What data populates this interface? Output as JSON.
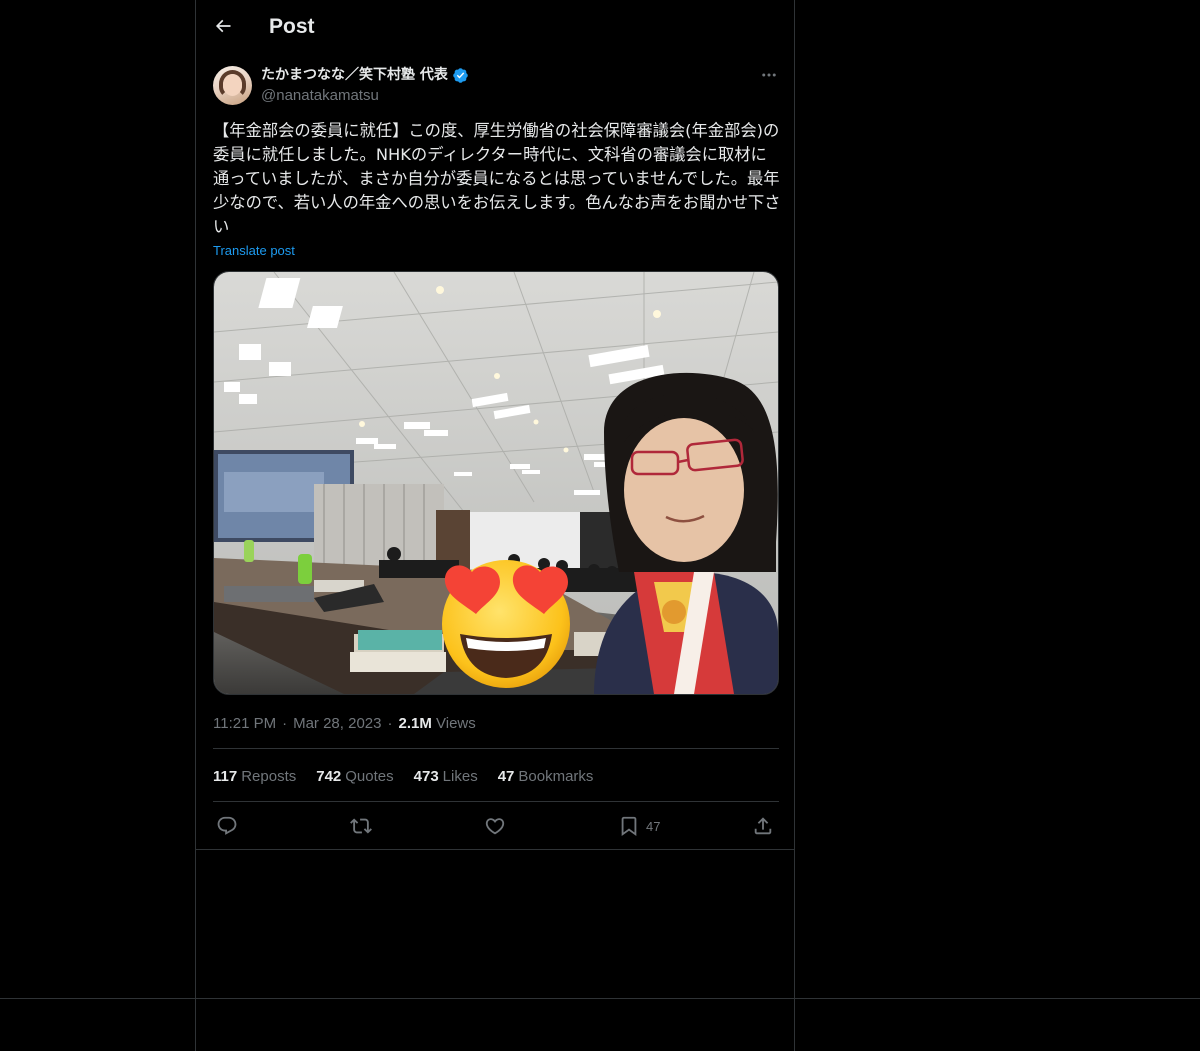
{
  "header": {
    "title": "Post",
    "back_icon": "arrow-left-icon"
  },
  "author": {
    "name": "たかまつなな／笑下村塾 代表",
    "handle": "@nanatakamatsu",
    "verified": true,
    "verified_color": "#1d9bf0"
  },
  "post": {
    "text": "【年金部会の委員に就任】この度、厚生労働省の社会保障審議会(年金部会)の委員に就任しました。NHKのディレクター時代に、文科省の審議会に取材に通っていましたが、まさか自分が委員になるとは思っていませんでした。最年少なので、若い人の年金への思いをお伝えします。色んなお声をお聞かせ下さい",
    "translate_label": "Translate post",
    "media_emoji": "😍"
  },
  "meta": {
    "time": "11:21 PM",
    "date": "Mar 28, 2023",
    "views_count": "2.1M",
    "views_label": "Views"
  },
  "stats": {
    "reposts_count": "117",
    "reposts_label": "Reposts",
    "quotes_count": "742",
    "quotes_label": "Quotes",
    "likes_count": "473",
    "likes_label": "Likes",
    "bookmarks_count": "47",
    "bookmarks_label": "Bookmarks"
  },
  "actions": {
    "reply_icon": "reply-icon",
    "repost_icon": "repost-icon",
    "like_icon": "heart-icon",
    "bookmark_icon": "bookmark-icon",
    "bookmark_count": "47",
    "share_icon": "share-icon"
  },
  "colors": {
    "background": "#000000",
    "text_primary": "#e7e9ea",
    "text_secondary": "#71767b",
    "link": "#1d9bf0",
    "border": "#2f3336"
  }
}
